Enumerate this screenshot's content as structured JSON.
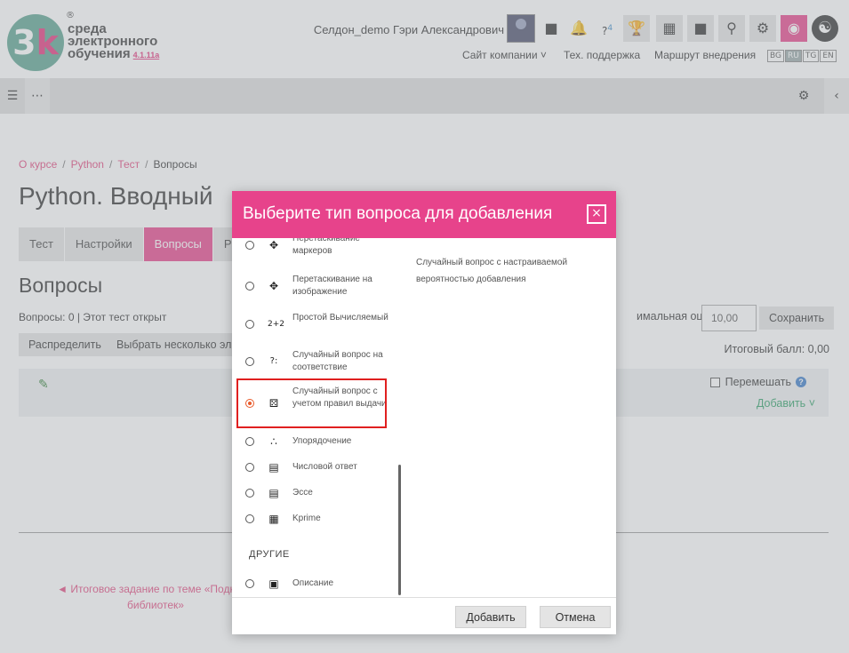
{
  "logo": {
    "mark": "3",
    "mark_k": "k",
    "reg": "®",
    "line1": "среда",
    "line2": "электронного",
    "line3": "обучения",
    "version": "4.1.11a"
  },
  "header": {
    "user_name": "Селдон_demo Гэри Александрович",
    "badge_count": "4",
    "links": [
      "Сайт компании",
      "Тех. поддержка",
      "Маршрут внедрения"
    ],
    "languages": [
      "BG",
      "RU",
      "TG",
      "EN"
    ],
    "active_language": "RU"
  },
  "breadcrumb": [
    "О курсе",
    "Python",
    "Тест",
    "Вопросы"
  ],
  "page": {
    "title": "Python. Вводный",
    "tabs": [
      "Тест",
      "Настройки",
      "Вопросы",
      "Р"
    ],
    "active_tab": "Вопросы",
    "section_title": "Вопросы",
    "status": "Вопросы: 0 | Этот тест открыт",
    "repaginate_label": "Распределить",
    "select_multiple_label": "Выбрать несколько элем",
    "max_grade_label": "имальная оценка",
    "max_grade_value": "10,00",
    "save_label": "Сохранить",
    "total_label": "Итоговый балл: 0,00",
    "shuffle_label": "Перемешать",
    "add_label": "Добавить",
    "prev_link_line1": "◄ Итоговое задание по теме «Подключ",
    "prev_link_line2": "библиотек»"
  },
  "modal": {
    "title": "Выберите тип вопроса для добавления",
    "close_label": "×",
    "options": [
      {
        "label": "Перетаскивание маркеров",
        "icon": "drag-markers-icon",
        "checked": false
      },
      {
        "label": "Перетаскивание на изображение",
        "icon": "drag-image-icon",
        "checked": false
      },
      {
        "label": "Простой Вычисляемый",
        "icon": "calculated-icon",
        "checked": false
      },
      {
        "label": "Случайный вопрос на соответствие",
        "icon": "random-match-icon",
        "checked": false
      },
      {
        "label": "Случайный вопрос с учетом правил выдачи",
        "icon": "dice-icon",
        "checked": true
      },
      {
        "label": "Упорядочение",
        "icon": "ordering-icon",
        "checked": false
      },
      {
        "label": "Числовой ответ",
        "icon": "numerical-icon",
        "checked": false
      },
      {
        "label": "Эссе",
        "icon": "essay-icon",
        "checked": false
      },
      {
        "label": "Kprime",
        "icon": "kprime-icon",
        "checked": false
      }
    ],
    "group_other": "ДРУГИЕ",
    "other_options": [
      {
        "label": "Описание",
        "icon": "description-icon",
        "checked": false
      }
    ],
    "description": "Случайный вопрос с настраиваемой вероятностью добавления",
    "add_button": "Добавить",
    "cancel_button": "Отмена"
  },
  "colors": {
    "accent": "#e7438b",
    "highlight": "#e02020",
    "link": "#e2487e",
    "success": "#2e9f66"
  }
}
